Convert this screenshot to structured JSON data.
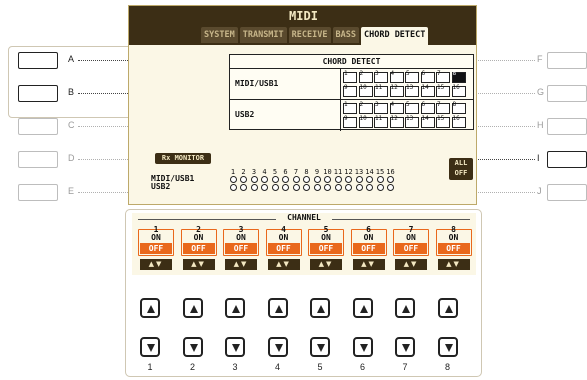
{
  "screen": {
    "title": "MIDI",
    "tabs": [
      "SYSTEM",
      "TRANSMIT",
      "RECEIVE",
      "BASS",
      "CHORD DETECT"
    ],
    "active_tab": "CHORD DETECT",
    "chord_detect": {
      "title": "CHORD DETECT",
      "rows": [
        {
          "label": "MIDI/USB1",
          "on_channels": [
            8
          ]
        },
        {
          "label": "USB2",
          "on_channels": []
        }
      ],
      "channel_numbers": [
        "1",
        "2",
        "3",
        "4",
        "5",
        "6",
        "7",
        "8",
        "9",
        "10",
        "11",
        "12",
        "13",
        "14",
        "15",
        "16"
      ]
    },
    "rx_monitor": {
      "label": "Rx MONITOR",
      "rows": [
        "MIDI/USB1",
        "USB2"
      ],
      "channels": [
        "1",
        "2",
        "3",
        "4",
        "5",
        "6",
        "7",
        "8",
        "9",
        "10",
        "11",
        "12",
        "13",
        "14",
        "15",
        "16"
      ]
    },
    "all_off": {
      "line1": "ALL",
      "line2": "OFF"
    }
  },
  "channel_strip": {
    "header": "CHANNEL",
    "columns": [
      {
        "num": "1",
        "on": "ON",
        "off": "OFF"
      },
      {
        "num": "2",
        "on": "ON",
        "off": "OFF"
      },
      {
        "num": "3",
        "on": "ON",
        "off": "OFF"
      },
      {
        "num": "4",
        "on": "ON",
        "off": "OFF"
      },
      {
        "num": "5",
        "on": "ON",
        "off": "OFF"
      },
      {
        "num": "6",
        "on": "ON",
        "off": "OFF"
      },
      {
        "num": "7",
        "on": "ON",
        "off": "OFF"
      },
      {
        "num": "8",
        "on": "ON",
        "off": "OFF"
      }
    ],
    "selected_value": "OFF",
    "arrows": "▲▼",
    "physical_labels": [
      "1",
      "2",
      "3",
      "4",
      "5",
      "6",
      "7",
      "8"
    ]
  },
  "side_buttons": {
    "left": [
      "A",
      "B",
      "C",
      "D",
      "E"
    ],
    "right": [
      "F",
      "G",
      "H",
      "I",
      "J"
    ],
    "active_left": [
      "A",
      "B"
    ],
    "active_right": [
      "I"
    ]
  },
  "colors": {
    "accent": "#e9681c",
    "screen_bg": "#fbf7e6",
    "header_bg": "#3c2e15"
  }
}
